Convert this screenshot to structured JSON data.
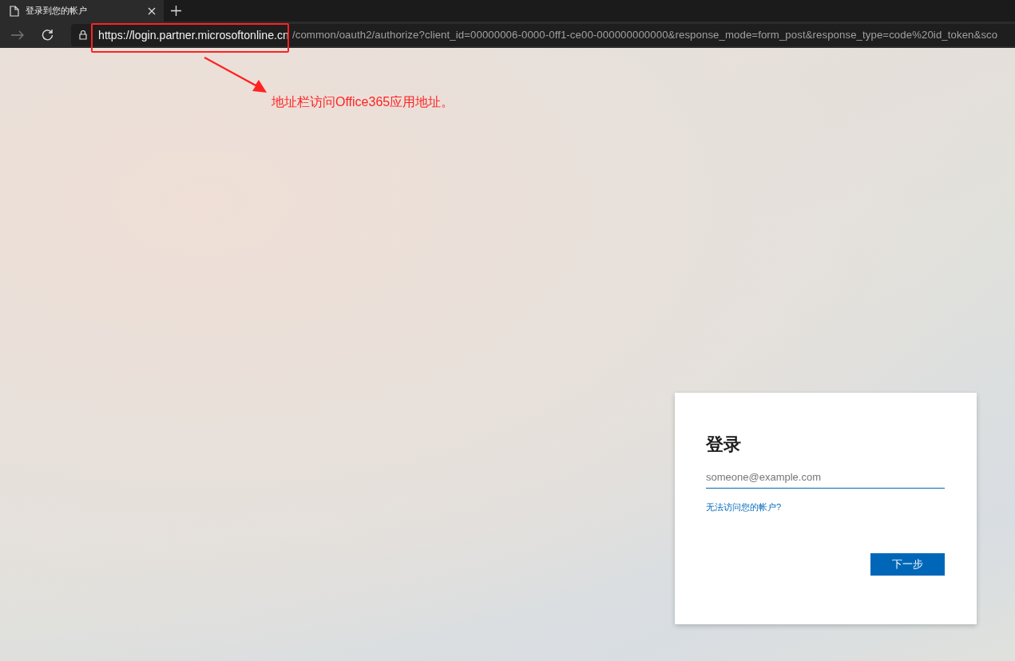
{
  "tab": {
    "title": "登录到您的帐户",
    "selected": true
  },
  "address_bar": {
    "host": "https://login.partner.microsoftonline.cn",
    "path": "/common/oauth2/authorize?client_id=00000006-0000-0ff1-ce00-000000000000&response_mode=form_post&response_type=code%20id_token&sco"
  },
  "annotation": {
    "text": "地址栏访问Office365应用地址。"
  },
  "signin": {
    "title": "登录",
    "email_placeholder": "someone@example.com",
    "help_link": "无法访问您的帐户?",
    "next_button": "下一步"
  }
}
